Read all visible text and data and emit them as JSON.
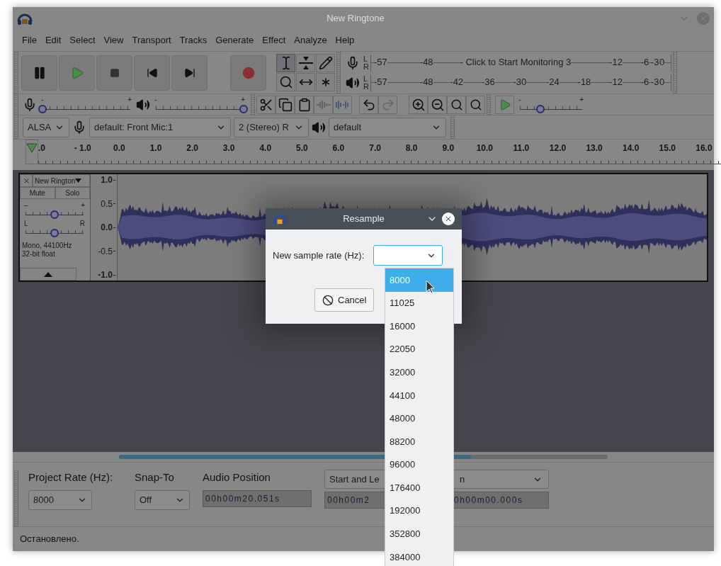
{
  "window": {
    "title": "New Ringtone"
  },
  "menu": [
    "File",
    "Edit",
    "Select",
    "View",
    "Transport",
    "Tracks",
    "Generate",
    "Effect",
    "Analyze",
    "Help"
  ],
  "tools": [
    {
      "kind": "select",
      "selected": true
    },
    {
      "kind": "envelope",
      "selected": false
    },
    {
      "kind": "draw",
      "selected": false
    },
    {
      "kind": "zoom",
      "selected": false
    },
    {
      "kind": "timeshift",
      "selected": false
    },
    {
      "kind": "multi",
      "selected": false
    }
  ],
  "record_meter": {
    "channels": [
      "L",
      "R"
    ],
    "ticks": [
      "-57",
      "-48",
      "- Click to Start Monitoring 3",
      "-12",
      "-6",
      "-3",
      "0"
    ]
  },
  "playback_meter": {
    "channels": [
      "L",
      "R"
    ],
    "ticks": [
      "-57",
      "-48",
      "-42",
      "-36",
      "-30",
      "-24",
      "-18",
      "-12",
      "-6",
      "-3",
      "0"
    ]
  },
  "mixer": [
    {
      "kind": "recording",
      "min": "-",
      "max": "+",
      "level": 0
    },
    {
      "kind": "playback",
      "min": "-",
      "max": "+",
      "level": 1
    }
  ],
  "play_at_speed": {
    "min": "-",
    "max": "+",
    "level": 0.33
  },
  "devices": {
    "host": "ALSA",
    "input": "default: Front Mic:1",
    "channels": "2 (Stereo) R",
    "output": "default"
  },
  "ruler": [
    ".0",
    "- 1.0",
    "0.0",
    "1.0",
    "2.0",
    "3.0",
    "4.0",
    "5.0",
    "6.0",
    "7.0",
    "8.0",
    "9.0",
    "10.0",
    "11.0",
    "12.0",
    "13.0",
    "14.0",
    "15.0",
    "16.0"
  ],
  "track": {
    "name": "New Rington",
    "mute": "Mute",
    "solo": "Solo",
    "gain": {
      "min": "–",
      "max": "+",
      "level": 0.5
    },
    "pan": {
      "min": "L",
      "max": "R",
      "level": 0.5
    },
    "info": [
      "Mono, 44100Hz",
      "32-bit float"
    ],
    "scale": [
      {
        "label": "1.0",
        "major": true
      },
      {
        "label": "0.5",
        "major": false
      },
      {
        "label": "0.0",
        "major": true
      },
      {
        "label": "-0.5",
        "major": false
      },
      {
        "label": "-1.0",
        "major": true
      }
    ]
  },
  "selection_toolbar": {
    "project_rate_label": "Project Rate (Hz):",
    "project_rate": "8000",
    "snap_label": "Snap-To",
    "snap": "Off",
    "position_label": "Audio Position",
    "position": "00h00m20.051s",
    "selection_mode": [
      "Start and Le",
      "n"
    ],
    "selection_start": "00h00m2",
    "selection_end": "0h00m00.000s"
  },
  "status_bar": "Остановлено.",
  "dialog": {
    "title": "Resample",
    "label": "New sample rate (Hz):",
    "cancel": "Cancel",
    "options": [
      {
        "label": "8000",
        "selected": true
      },
      {
        "label": "11025",
        "selected": false
      },
      {
        "label": "16000",
        "selected": false
      },
      {
        "label": "22050",
        "selected": false
      },
      {
        "label": "32000",
        "selected": false
      },
      {
        "label": "44100",
        "selected": false
      },
      {
        "label": "48000",
        "selected": false
      },
      {
        "label": "88200",
        "selected": false
      },
      {
        "label": "96000",
        "selected": false
      },
      {
        "label": "176400",
        "selected": false
      },
      {
        "label": "192000",
        "selected": false
      },
      {
        "label": "352800",
        "selected": false
      },
      {
        "label": "384000",
        "selected": false
      }
    ]
  }
}
